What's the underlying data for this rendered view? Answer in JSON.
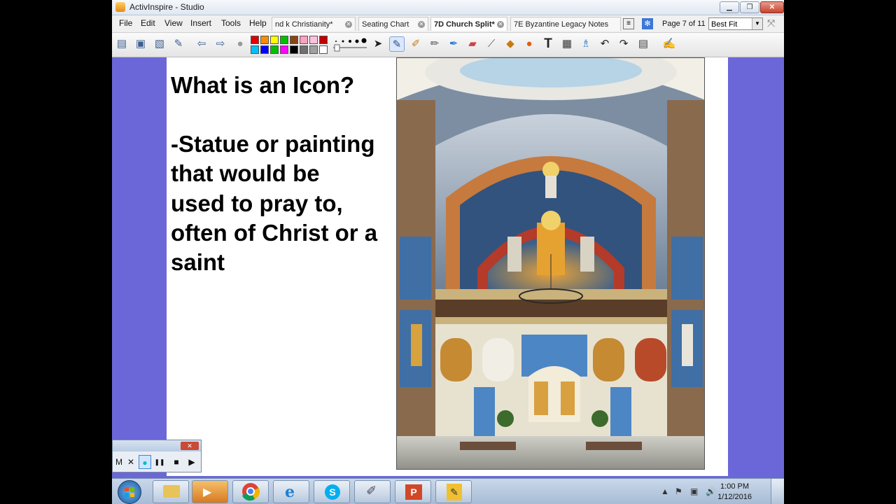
{
  "window": {
    "title": "ActivInspire - Studio",
    "minimize": "▁",
    "restore": "❐",
    "close": "✕"
  },
  "menu": [
    "File",
    "Edit",
    "View",
    "Insert",
    "Tools",
    "Help"
  ],
  "tabs": [
    {
      "label": "nd k Christianity*",
      "active": false
    },
    {
      "label": "Seating Chart",
      "active": false
    },
    {
      "label": "7D Church Split*",
      "active": true
    },
    {
      "label": "7E Byzantine Legacy Notes",
      "active": false
    }
  ],
  "page_indicator": "Page 7 of 11",
  "zoom": "Best Fit",
  "palette": [
    "#e00000",
    "#ff8c00",
    "#ffff00",
    "#00c000",
    "#8b4513",
    "#ffa0c0",
    "#ffc0e0",
    "#c00000",
    "#00c0ff",
    "#0000ff",
    "#00c000",
    "#ff00ff",
    "#000000",
    "#707070",
    "#a0a0a0",
    "#ffffff"
  ],
  "slide": {
    "lines": [
      "What is an Icon?",
      "",
      "-Statue or painting",
      "that would be",
      "used to pray to,",
      "often of Christ or a",
      "saint"
    ]
  },
  "recorder": {
    "buttons": [
      "M",
      "✕",
      "●",
      "❚❚",
      "■",
      "▶"
    ]
  },
  "clock": {
    "time": "1:00 PM",
    "date": "1/12/2016"
  },
  "tray": [
    "▲",
    "⚑",
    "▣",
    "🔊"
  ]
}
